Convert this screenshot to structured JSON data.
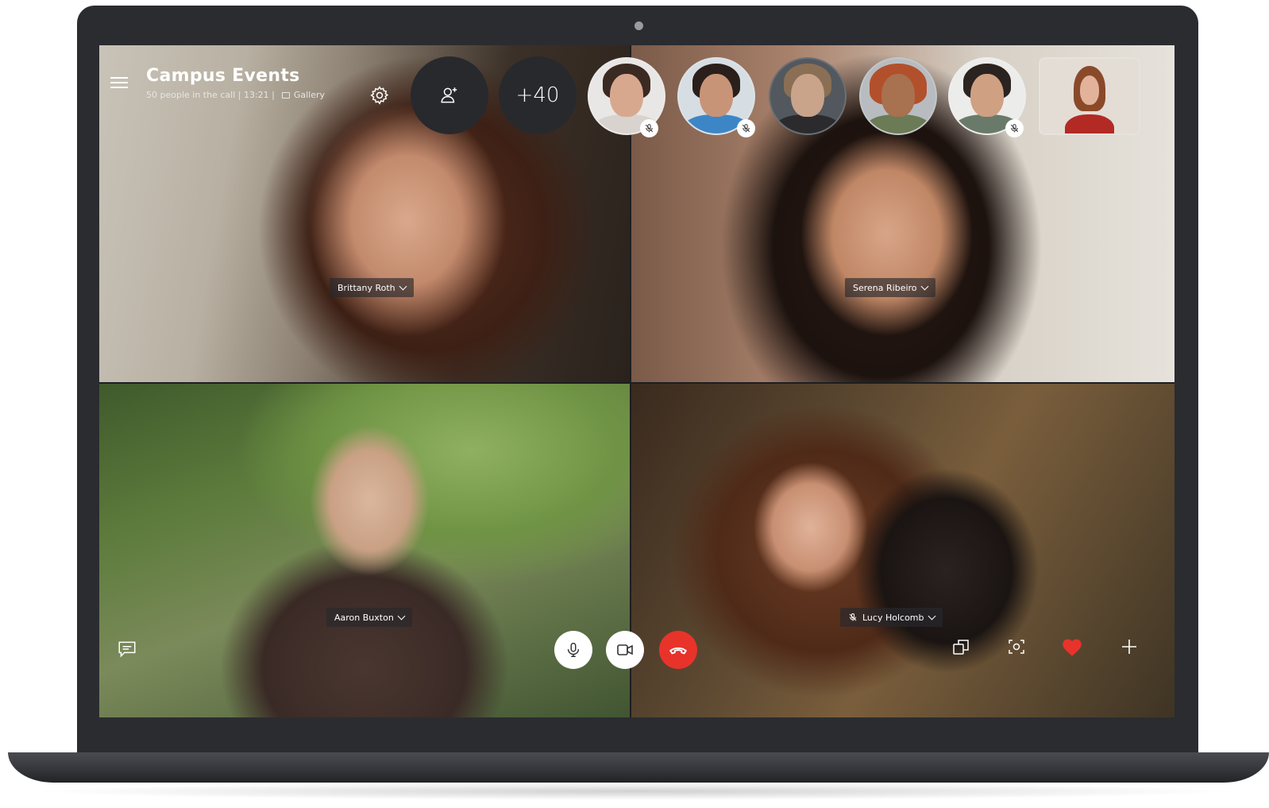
{
  "window": {
    "title": "Campus Events",
    "subtitle": "50 people in the call | 13:21 |",
    "view_mode": "Gallery"
  },
  "header": {
    "menu_icon": "hamburger-icon",
    "settings_icon": "gear-icon",
    "add_people_icon": "add-person-icon",
    "more_participants_label": "+40"
  },
  "participants_strip": [
    {
      "muted": true,
      "kind": "avatar"
    },
    {
      "muted": true,
      "kind": "avatar"
    },
    {
      "muted": false,
      "kind": "avatar"
    },
    {
      "muted": false,
      "kind": "avatar"
    },
    {
      "muted": true,
      "kind": "avatar"
    },
    {
      "muted": false,
      "kind": "video-thumbnail"
    }
  ],
  "video_tiles": [
    {
      "name": "Brittany Roth",
      "muted": false
    },
    {
      "name": "Serena Ribeiro",
      "muted": false
    },
    {
      "name": "Aaron Buxton",
      "muted": false
    },
    {
      "name": "Lucy Holcomb",
      "muted": true
    }
  ],
  "controls": {
    "chat_icon": "chat-icon",
    "mic_icon": "microphone-icon",
    "video_icon": "video-camera-icon",
    "end_call_icon": "hang-up-icon",
    "switch_camera_icon": "switch-camera-icon",
    "snapshot_icon": "snapshot-icon",
    "react_icon": "heart-icon",
    "add_icon": "plus-icon"
  },
  "colors": {
    "end_call": "#e8332b",
    "heart": "#e8332b",
    "frame": "#2b2c30",
    "round_button": "#28292d"
  }
}
